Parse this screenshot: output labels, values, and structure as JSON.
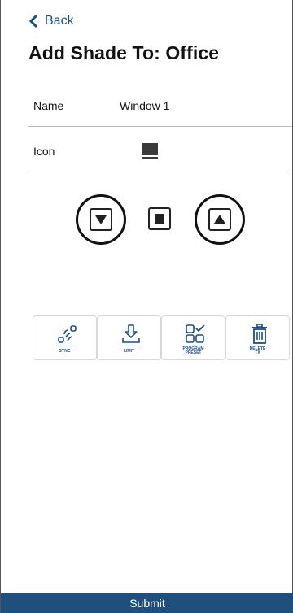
{
  "header": {
    "back_label": "Back",
    "title": "Add Shade To: Office"
  },
  "form": {
    "name_label": "Name",
    "name_value": "Window 1",
    "icon_label": "Icon",
    "icon_name": "shade-icon"
  },
  "controls": {
    "down_icon": "triangle-down-icon",
    "stop_icon": "square-stop-icon",
    "up_icon": "triangle-up-icon"
  },
  "tools": [
    {
      "label": "SYNC",
      "icon": "sync-wireless-icon"
    },
    {
      "label": "LIMIT",
      "icon": "limit-download-icon"
    },
    {
      "label_line1": "PROGRAM",
      "label_line2": "PRESET",
      "icon": "program-preset-icon"
    },
    {
      "label_line1": "DELETE",
      "label_line2": "TX",
      "icon": "trash-icon"
    }
  ],
  "footer": {
    "submit_label": "Submit"
  },
  "colors": {
    "accent": "#1c4f8a",
    "submit_bg": "#1e4f7d"
  }
}
